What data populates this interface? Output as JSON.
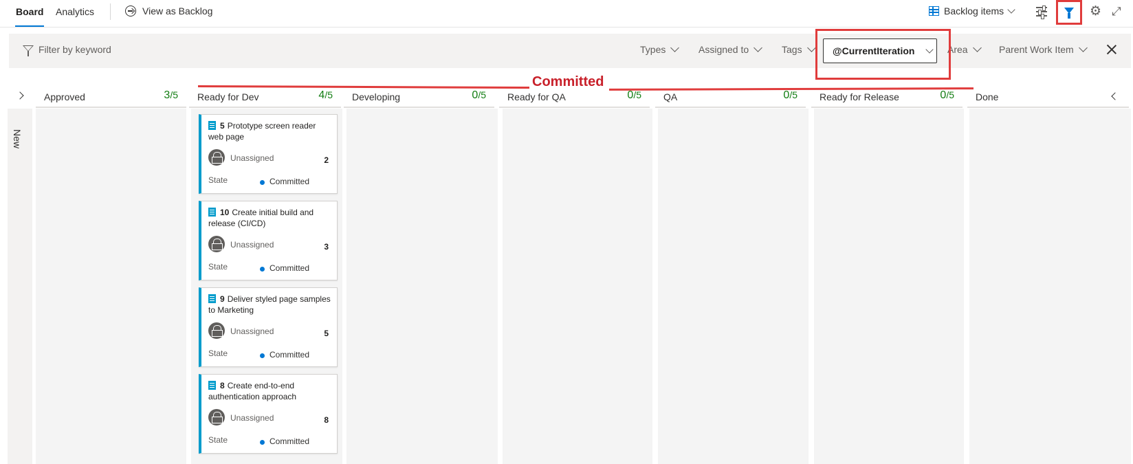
{
  "tabs": {
    "board": "Board",
    "analytics": "Analytics",
    "view_as_backlog": "View as Backlog"
  },
  "toolbar": {
    "backlog_selector": "Backlog items"
  },
  "filter": {
    "keyword_placeholder": "Filter by keyword",
    "types": "Types",
    "assigned_to": "Assigned to",
    "tags": "Tags",
    "iteration": "@CurrentIteration",
    "area": "Area",
    "parent_work_item": "Parent Work Item"
  },
  "annotation": {
    "label": "Committed",
    "color": "#c8202a"
  },
  "swimlane": {
    "label": "New"
  },
  "columns": [
    {
      "name": "Approved",
      "count": "3",
      "limit": "/5"
    },
    {
      "name": "Ready for Dev",
      "count": "4",
      "limit": "/5"
    },
    {
      "name": "Developing",
      "count": "0",
      "limit": "/5"
    },
    {
      "name": "Ready for QA",
      "count": "0",
      "limit": "/5"
    },
    {
      "name": "QA",
      "count": "0",
      "limit": "/5"
    },
    {
      "name": "Ready for Release",
      "count": "0",
      "limit": "/5"
    },
    {
      "name": "Done",
      "count": "",
      "limit": ""
    }
  ],
  "cards": [
    {
      "id": "5",
      "title": "Prototype screen reader web page",
      "assignee": "Unassigned",
      "effort": "2",
      "state_label": "State",
      "state": "Committed"
    },
    {
      "id": "10",
      "title": "Create initial build and release (CI/CD)",
      "assignee": "Unassigned",
      "effort": "3",
      "state_label": "State",
      "state": "Committed"
    },
    {
      "id": "9",
      "title": "Deliver styled page samples to Marketing",
      "assignee": "Unassigned",
      "effort": "5",
      "state_label": "State",
      "state": "Committed"
    },
    {
      "id": "8",
      "title": "Create end-to-end authentication approach",
      "assignee": "Unassigned",
      "effort": "8",
      "state_label": "State",
      "state": "Committed"
    }
  ],
  "icons": {
    "view_as_backlog": "circle-arrow-right-icon",
    "backlog_selector": "grid-icon",
    "settings": "gear-icon",
    "column_options": "sliders-icon",
    "filter": "funnel-icon",
    "fullscreen": "expand-icon"
  },
  "colors": {
    "accent": "#0078d4",
    "card_stripe": "#009ccc",
    "wip_count": "#107c10",
    "highlight_box": "#e03c3c"
  }
}
